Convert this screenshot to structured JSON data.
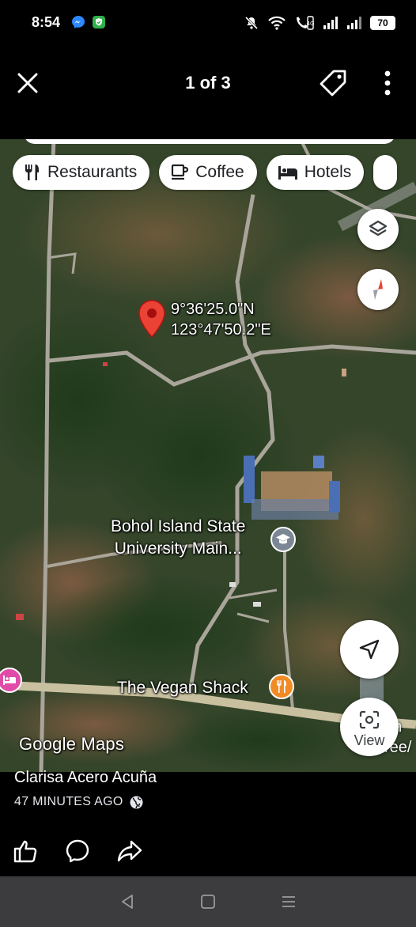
{
  "status_bar": {
    "time": "8:54",
    "battery": "70",
    "icons": [
      "messenger-icon",
      "shield-icon",
      "mute-icon",
      "wifi-icon",
      "volte-icon",
      "signal-icon",
      "signal-icon",
      "battery-icon"
    ]
  },
  "header": {
    "page_counter": "1 of 3",
    "close_icon": "close-icon",
    "tag_icon": "tag-icon",
    "more_icon": "more-vertical-icon"
  },
  "map": {
    "chips": [
      {
        "label": "Restaurants",
        "icon": "fork-knife-icon"
      },
      {
        "label": "Coffee",
        "icon": "coffee-cup-icon"
      },
      {
        "label": "Hotels",
        "icon": "bed-icon"
      }
    ],
    "pin": {
      "lat": "9°36'25.0\"N",
      "lng": "123°47'50.2\"E"
    },
    "places": [
      {
        "line1": "Bohol Island State",
        "line2": "University Main...",
        "icon": "graduation-cap-icon"
      },
      {
        "label": "The Vegan Shack",
        "icon": "restaurant-icon"
      }
    ],
    "cut_off_text": {
      "line1": "an",
      "line2": "ree/"
    },
    "google_logo": "Google Maps",
    "view_button": "View",
    "colors": {
      "pin": "#ea4335",
      "restaurant": "#f28b24",
      "hotel": "#e04ba8",
      "school": "#7b8794",
      "road": "#c9c0a0"
    }
  },
  "post": {
    "author": "Clarisa Acero Acuña",
    "time": "47 MINUTES AGO",
    "privacy_icon": "globe-icon",
    "actions": [
      "like-icon",
      "comment-icon",
      "share-icon"
    ]
  },
  "nav_bar": [
    "back-icon",
    "home-icon",
    "recents-icon"
  ]
}
